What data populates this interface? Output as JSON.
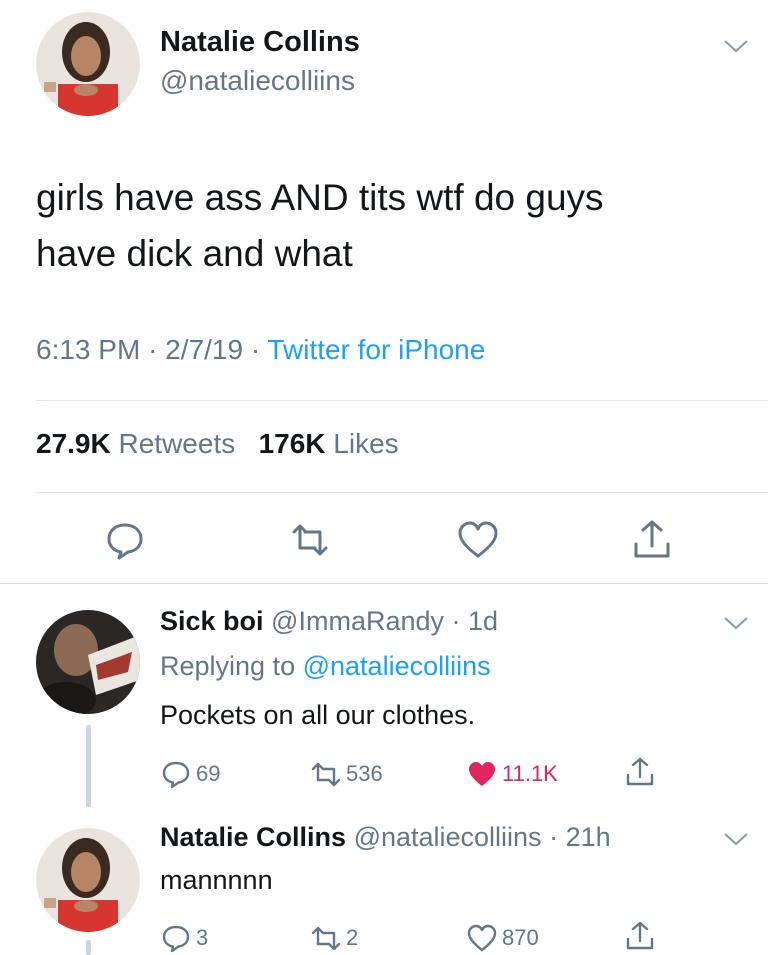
{
  "main_tweet": {
    "author_name": "Natalie Collins",
    "author_handle": "@nataliecolliins",
    "text_line1": "girls have ass AND tits wtf do guys",
    "text_line2": "have dick and what",
    "time": "6:13 PM",
    "date": "2/7/19",
    "source": "Twitter for iPhone",
    "separator": "·",
    "retweet_count": "27.9K",
    "retweet_label": "Retweets",
    "like_count": "176K",
    "like_label": "Likes",
    "icons": [
      "reply-icon",
      "retweet-icon",
      "heart-icon",
      "share-icon",
      "chevron-down-icon"
    ]
  },
  "replies": [
    {
      "author_name": "Sick boi",
      "author_handle": "@ImmaRandy",
      "age": "· 1d",
      "replying_label": "Replying to",
      "replying_handle": "@nataliecolliins",
      "text": "Pockets on all our clothes.",
      "reply_count": "69",
      "retweet_count": "536",
      "like_count": "11.1K",
      "liked": true
    },
    {
      "author_name": "Natalie Collins",
      "author_handle": "@nataliecolliins",
      "age": "· 21h",
      "text": "mannnnn",
      "reply_count": "3",
      "retweet_count": "2",
      "like_count": "870",
      "liked": false
    }
  ],
  "colors": {
    "accent": "#1da1f2",
    "liked": "#e0245e",
    "muted": "#657786",
    "text": "#14171a"
  }
}
